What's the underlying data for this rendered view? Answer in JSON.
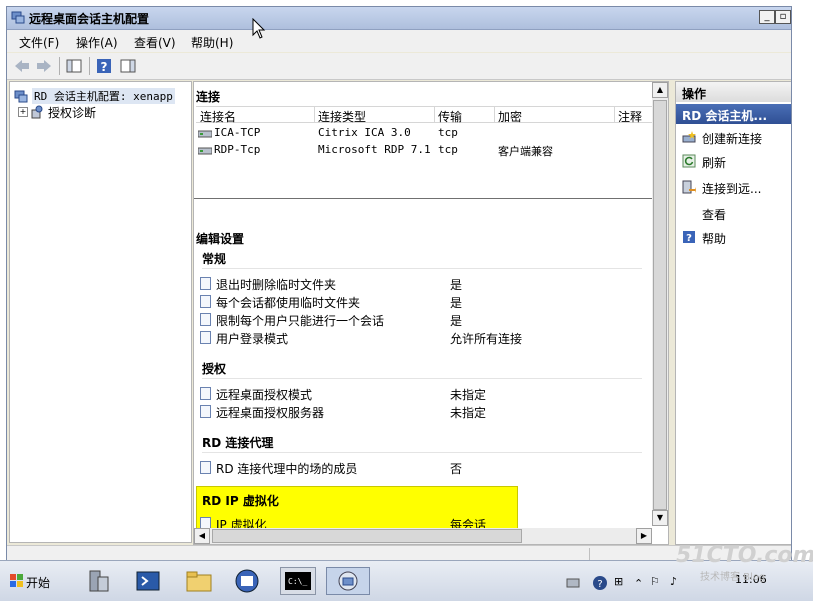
{
  "window": {
    "title": "远程桌面会话主机配置"
  },
  "menu": [
    "文件(F)",
    "操作(A)",
    "查看(V)",
    "帮助(H)"
  ],
  "tree": {
    "root": "RD 会话主机配置: xenapp",
    "child": "授权诊断"
  },
  "connections": {
    "heading": "连接",
    "columns": [
      "连接名",
      "连接类型",
      "传输",
      "加密",
      "注释"
    ],
    "rows": [
      {
        "name": "ICA-TCP",
        "type": "Citrix ICA 3.0",
        "transport": "tcp",
        "encryption": ""
      },
      {
        "name": "RDP-Tcp",
        "type": "Microsoft RDP 7.1",
        "transport": "tcp",
        "encryption": "客户端兼容"
      }
    ]
  },
  "settings": {
    "heading": "编辑设置",
    "groups": [
      {
        "title": "常规",
        "items": [
          {
            "label": "退出时删除临时文件夹",
            "value": "是"
          },
          {
            "label": "每个会话都使用临时文件夹",
            "value": "是"
          },
          {
            "label": "限制每个用户只能进行一个会话",
            "value": "是"
          },
          {
            "label": "用户登录模式",
            "value": "允许所有连接"
          }
        ]
      },
      {
        "title": "授权",
        "items": [
          {
            "label": "远程桌面授权模式",
            "value": "未指定"
          },
          {
            "label": "远程桌面授权服务器",
            "value": "未指定"
          }
        ]
      },
      {
        "title": "RD 连接代理",
        "items": [
          {
            "label": "RD 连接代理中的场的成员",
            "value": "否"
          }
        ]
      },
      {
        "title": "RD IP 虚拟化",
        "items": [
          {
            "label": "IP 虚拟化",
            "value": "每会话"
          }
        ]
      }
    ]
  },
  "actions": {
    "heading": "操作",
    "sub": "RD 会话主机...",
    "items": [
      {
        "label": "创建新连接",
        "icon": "new-connection-icon"
      },
      {
        "label": "刷新",
        "icon": "refresh-icon"
      },
      {
        "label": "连接到远...",
        "icon": "connect-remote-icon"
      },
      {
        "label": "查看",
        "icon": ""
      },
      {
        "label": "帮助",
        "icon": "help-icon"
      }
    ]
  },
  "taskbar": {
    "start": "开始",
    "clock": "11:06"
  },
  "watermark": {
    "main": "51CTO.com",
    "sub": "技术博客 Blog"
  },
  "colors": {
    "highlight": "#ffff00",
    "actionHeader": "#2f4f94",
    "titlebar": "#aebfdd"
  }
}
